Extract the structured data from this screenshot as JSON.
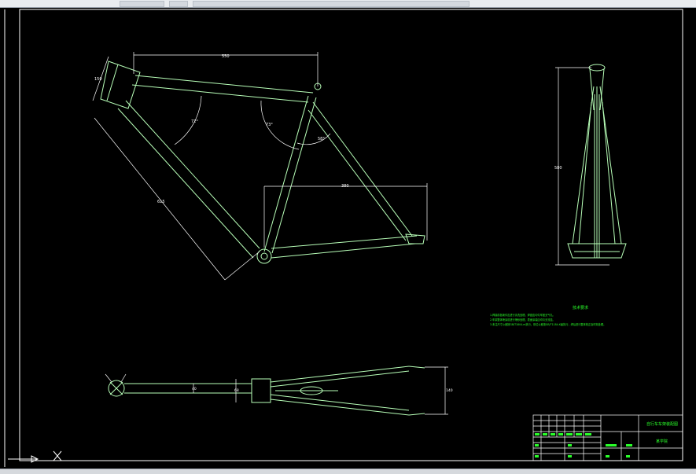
{
  "drawing": {
    "dim_top_tube": "550",
    "dim_head_tube": "150",
    "dim_down_tube": "615",
    "dim_seat_stay_span": "380",
    "dim_angle_head": "72°",
    "dim_angle_seat": "73°",
    "dim_seat_angle_b": "58°",
    "dim_front_height": "580",
    "dim_bottom_width": "140",
    "dim_bottom_hub": "40",
    "dim_bottom_bb": "68"
  },
  "notes": {
    "title": "技术要求",
    "line1": "1.焊接前各管件应进行清洗处理，焊缝应均匀牢固无气孔。",
    "line2": "2.车架整体喷涂前进行喷砂处理，表面涂装应均匀无流挂。",
    "line3": "3.未注尺寸公差按GB/T1804-m执行，形位公差按GB/T1184-K级执行，焊后进行整体校正及时效处理。"
  },
  "title_block": {
    "drawing_title": "自行车车架装配图",
    "company": "某学院"
  },
  "colors": {
    "background": "#000000",
    "lines": "#ffffff",
    "frame": "#b8ffb8",
    "text_green": "#2aff2a"
  }
}
